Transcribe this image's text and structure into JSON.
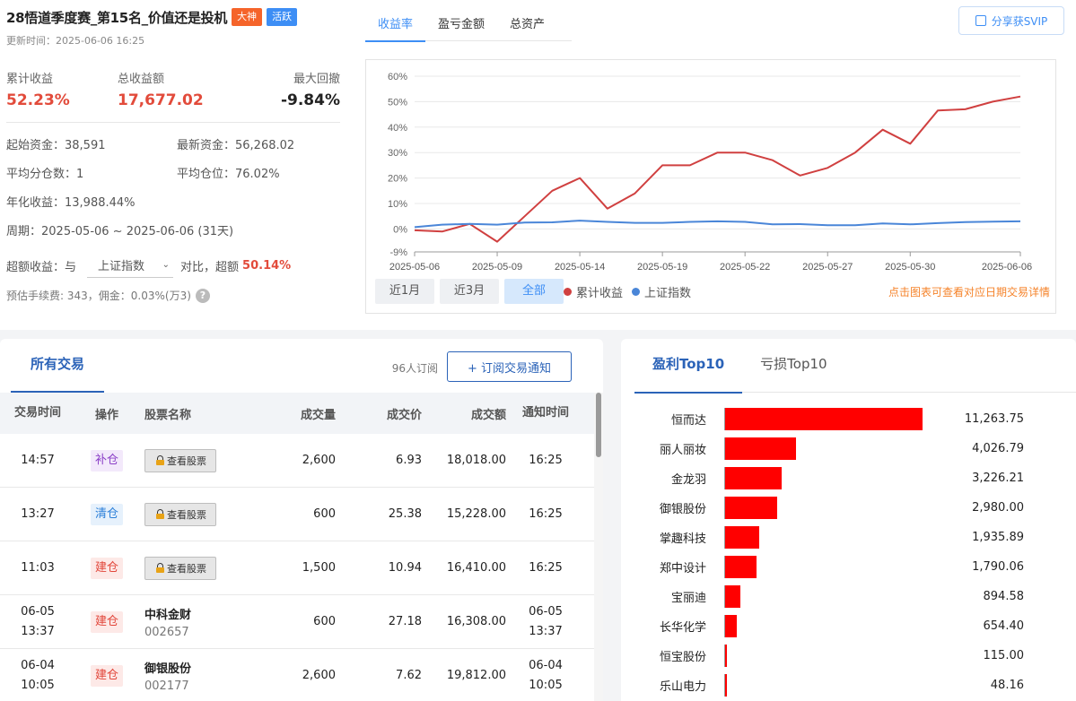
{
  "header": {
    "title": "28悟道季度赛_第15名_价值还是投机",
    "tag_master": "大神",
    "tag_active": "活跃",
    "updated": "更新时间：2025-06-06 16:25"
  },
  "colors": {
    "red": "#e24b3b",
    "blue": "#3d8ef5",
    "bar": "#ff0000",
    "orange": "#f5832a"
  },
  "summary": {
    "cum_return_label": "累计收益",
    "cum_return": "52.23%",
    "total_profit_label": "总收益额",
    "total_profit": "17,677.02",
    "max_drawdown_label": "最大回撤",
    "max_drawdown": "-9.84%"
  },
  "details": {
    "start_capital": "起始资金：38,591",
    "latest_capital": "最新资金：56,268.02",
    "avg_splits": "平均分仓数：1",
    "avg_position": "平均仓位：76.02%",
    "annualized": "年化收益：13,988.44%",
    "period": "周期：2025-05-06 ~ 2025-06-06 (31天)"
  },
  "excess": {
    "label": "超额收益：",
    "with": "与",
    "index": "上证指数",
    "compare": "对比，超额",
    "value": "50.14%"
  },
  "fees": "预估手续费: 343，佣金：0.03%(万3)",
  "chart_tabs": [
    "收益率",
    "盈亏金额",
    "总资产"
  ],
  "share_label": "分享获SVIP",
  "ranges": [
    "近1月",
    "近3月",
    "全部"
  ],
  "hint": "点击图表可查看对应日期交易详情",
  "chart_data": {
    "type": "line",
    "y_ticks": [
      "60%",
      "50%",
      "40%",
      "30%",
      "20%",
      "10%",
      "0%",
      "-9%"
    ],
    "ylim": [
      -9,
      60
    ],
    "x_ticks": [
      "2025-05-06",
      "2025-05-09",
      "2025-05-14",
      "2025-05-19",
      "2025-05-22",
      "2025-05-27",
      "2025-05-30",
      "2025-06-06"
    ],
    "grid": true,
    "legend_position": "bottom",
    "series": [
      {
        "name": "累计收益",
        "color": "#d04040",
        "values": [
          -0.5,
          -1,
          2,
          -5,
          5,
          15,
          20,
          8,
          14,
          25,
          25,
          30,
          30,
          27,
          21,
          24,
          30,
          39,
          33.5,
          46.5,
          47,
          50,
          52
        ]
      },
      {
        "name": "上证指数",
        "color": "#4a86d8",
        "values": [
          0.7,
          1.7,
          2,
          1.7,
          2.5,
          2.6,
          3.3,
          2.8,
          2.4,
          2.4,
          2.8,
          3,
          2.8,
          1.8,
          1.9,
          1.5,
          1.5,
          2.2,
          1.8,
          2.3,
          2.7,
          2.9,
          3
        ]
      }
    ]
  },
  "trades": {
    "tab": "所有交易",
    "subscribers": "96人订阅",
    "subscribe_btn": "+ 订阅交易通知",
    "columns": [
      "交易时间",
      "操作",
      "股票名称",
      "成交量",
      "成交价",
      "成交额",
      "通知时间"
    ],
    "view_label": "查看股票",
    "rows": [
      {
        "time1": "14:57",
        "time2": "",
        "op": "补仓",
        "tone": "purple",
        "locked": true,
        "name": "",
        "code": "",
        "qty": "2,600",
        "price": "6.93",
        "amount": "18,018.00",
        "n1": "16:25",
        "n2": ""
      },
      {
        "time1": "13:27",
        "time2": "",
        "op": "清仓",
        "tone": "blue",
        "locked": true,
        "name": "",
        "code": "",
        "qty": "600",
        "price": "25.38",
        "amount": "15,228.00",
        "n1": "16:25",
        "n2": ""
      },
      {
        "time1": "11:03",
        "time2": "",
        "op": "建仓",
        "tone": "red",
        "locked": true,
        "name": "",
        "code": "",
        "qty": "1,500",
        "price": "10.94",
        "amount": "16,410.00",
        "n1": "16:25",
        "n2": ""
      },
      {
        "time1": "06-05",
        "time2": "13:37",
        "op": "建仓",
        "tone": "red",
        "locked": false,
        "name": "中科金财",
        "code": "002657",
        "qty": "600",
        "price": "27.18",
        "amount": "16,308.00",
        "n1": "06-05",
        "n2": "13:37"
      },
      {
        "time1": "06-04",
        "time2": "10:05",
        "op": "建仓",
        "tone": "red",
        "locked": false,
        "name": "御银股份",
        "code": "002177",
        "qty": "2,600",
        "price": "7.62",
        "amount": "19,812.00",
        "n1": "06-04",
        "n2": "10:05"
      }
    ]
  },
  "top10": {
    "tabs": [
      "盈利Top10",
      "亏损Top10"
    ],
    "max": 11263.75,
    "items": [
      {
        "name": "恒而达",
        "value": 11263.75,
        "label": "11,263.75"
      },
      {
        "name": "丽人丽妆",
        "value": 4026.79,
        "label": "4,026.79"
      },
      {
        "name": "金龙羽",
        "value": 3226.21,
        "label": "3,226.21"
      },
      {
        "name": "御银股份",
        "value": 2980.0,
        "label": "2,980.00"
      },
      {
        "name": "掌趣科技",
        "value": 1935.89,
        "label": "1,935.89"
      },
      {
        "name": "郑中设计",
        "value": 1790.06,
        "label": "1,790.06"
      },
      {
        "name": "宝丽迪",
        "value": 894.58,
        "label": "894.58"
      },
      {
        "name": "长华化学",
        "value": 654.4,
        "label": "654.40"
      },
      {
        "name": "恒宝股份",
        "value": 115.0,
        "label": "115.00"
      },
      {
        "name": "乐山电力",
        "value": 48.16,
        "label": "48.16"
      }
    ]
  }
}
